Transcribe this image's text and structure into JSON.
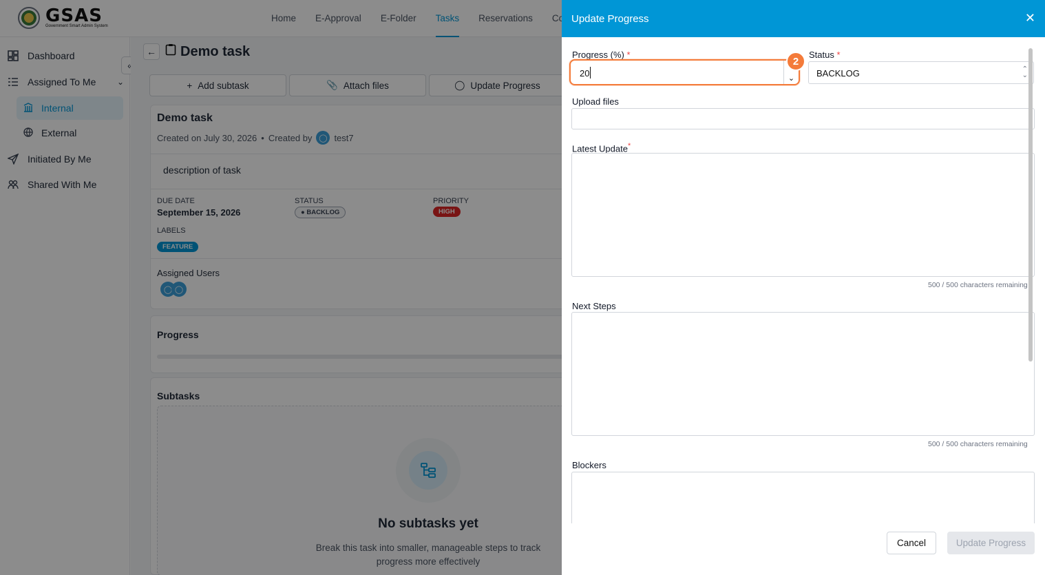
{
  "logo": {
    "name": "GSAS",
    "subtitle": "Government Smart Admin System"
  },
  "nav": [
    "Home",
    "E-Approval",
    "E-Folder",
    "Tasks",
    "Reservations",
    "Co"
  ],
  "sidebar": {
    "dashboard": "Dashboard",
    "assigned": "Assigned To Me",
    "internal": "Internal",
    "external": "External",
    "initiated": "Initiated By Me",
    "shared": "Shared With Me"
  },
  "task": {
    "title": "Demo task",
    "created": "Created on July 30, 2026",
    "created_by": "Created by",
    "creator": "test7",
    "description": "description of task",
    "due_label": "DUE DATE",
    "due_value": "September 15, 2026",
    "status_label": "STATUS",
    "status_value": "BACKLOG",
    "priority_label": "PRIORITY",
    "priority_value": "HIGH",
    "labels_label": "LABELS",
    "label_value": "FEATURE",
    "assigned_label": "Assigned Users",
    "progress_label": "Progress",
    "subtasks_label": "Subtasks",
    "no_subtasks": "No subtasks yet",
    "no_subtasks_hint_1": "Break this task into smaller, manageable steps to track",
    "no_subtasks_hint_2": "progress more effectively"
  },
  "actions": {
    "add_subtask": "Add subtask",
    "attach": "Attach files",
    "update": "Update Progress"
  },
  "drawer": {
    "title": "Update Progress",
    "progress_label": "Progress (%)",
    "progress_value": "20",
    "status_label": "Status",
    "status_value": "BACKLOG",
    "upload_label": "Upload files",
    "latest_label": "Latest Update",
    "latest_count": "500 / 500 characters remaining",
    "next_label": "Next Steps",
    "next_count": "500 / 500 characters remaining",
    "blockers_label": "Blockers",
    "cancel": "Cancel",
    "submit": "Update Progress",
    "step_badge": "2"
  },
  "colors": {
    "accent": "#0096d6",
    "highlight": "#f47b3a",
    "priority": "#dc2626"
  }
}
